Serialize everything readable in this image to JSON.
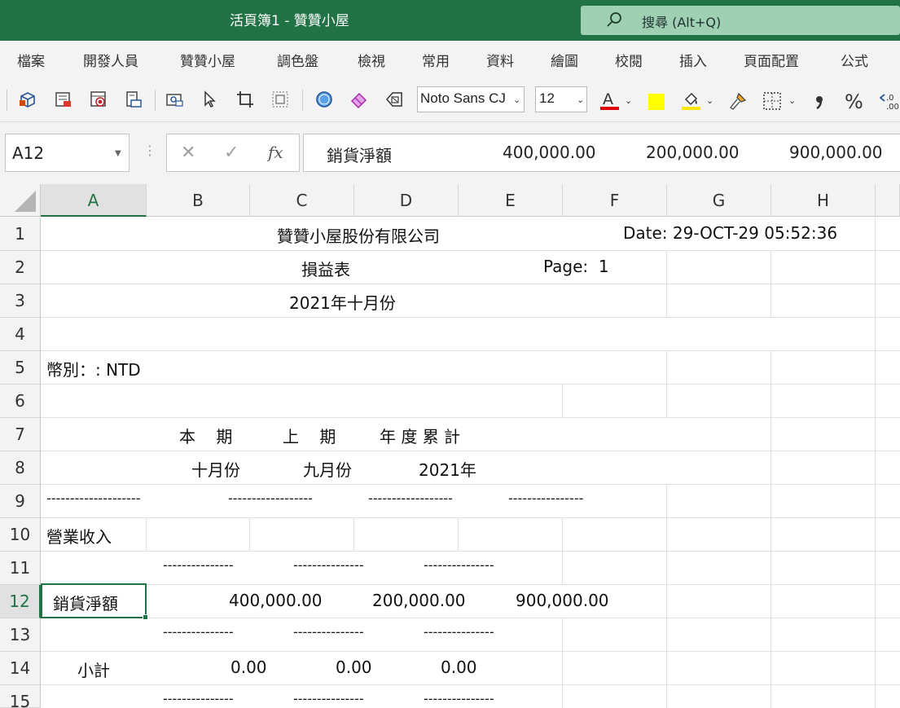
{
  "window": {
    "title": "活頁簿1  -  贊贊小屋"
  },
  "search": {
    "text": "搜尋 (Alt+Q)"
  },
  "ribbon": {
    "tabs": [
      "檔案",
      "開發人員",
      "贊贊小屋",
      "調色盤",
      "檢視",
      "常用",
      "資料",
      "繪圖",
      "校閱",
      "插入",
      "頁面配置",
      "公式"
    ]
  },
  "toolbar": {
    "font_name": "Noto Sans CJ",
    "font_size": "12",
    "font_color": "#e00000",
    "fill_color": "#ffff00",
    "highlight_color": "#ffe800",
    "icons": [
      "excel-3d-icon",
      "form-icon",
      "record-macro-icon",
      "print-preview-icon",
      "camera-icon",
      "select-pointer-icon",
      "crop-icon",
      "group-objects-icon",
      "circle-shape-icon",
      "eraser-icon",
      "clear-format-icon",
      "font-color-icon",
      "fill-color-icon",
      "highlight-icon",
      "format-painter-icon",
      "borders-icon",
      "comma-style-icon",
      "percent-style-icon",
      "decimal-icon"
    ]
  },
  "formula_bar": {
    "cell_ref": "A12",
    "cancel": "✕",
    "enter": "✓",
    "fx": "fx",
    "content": {
      "label": "銷貨淨額",
      "v1": "400,000.00",
      "v2": "200,000.00",
      "v3": "900,000.00"
    }
  },
  "grid": {
    "columns": [
      "A",
      "B",
      "C",
      "D",
      "E",
      "F",
      "G",
      "H"
    ],
    "rows": [
      "1",
      "2",
      "3",
      "4",
      "5",
      "6",
      "7",
      "8",
      "9",
      "10",
      "11",
      "12",
      "13",
      "14",
      "15"
    ],
    "active_cell": "A12",
    "cells": {
      "company": "贊贊小屋股份有限公司",
      "date": "Date: 29-OCT-29 05:52:36",
      "report": "損益表",
      "page": "Page:  1",
      "period": "2021年十月份",
      "currency": "幣別：: NTD",
      "h_current": "本    期",
      "h_prior": "上    期",
      "h_ytd": "年 度 累 計",
      "sub_current": "十月份",
      "sub_prior": "九月份",
      "sub_ytd": "2021年",
      "dash_a": "--------------------",
      "dash_b": "------------------",
      "dash_c": "------------------",
      "dash_d": "----------------",
      "dash_col": "---------------",
      "revenue": "營業收入",
      "net_sales": "銷貨淨額",
      "net_sales_current": "400,000.00",
      "net_sales_prior": "200,000.00",
      "net_sales_ytd": "900,000.00",
      "subtotal": "小計",
      "subtotal_current": "0.00",
      "subtotal_prior": "0.00",
      "subtotal_ytd": "0.00"
    }
  }
}
